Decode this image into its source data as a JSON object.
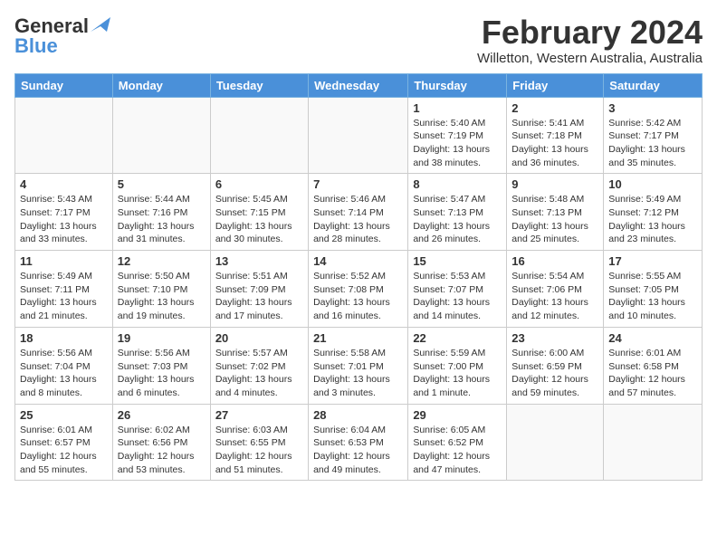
{
  "header": {
    "logo_line1": "General",
    "logo_line2": "Blue",
    "title": "February 2024",
    "subtitle": "Willetton, Western Australia, Australia"
  },
  "columns": [
    "Sunday",
    "Monday",
    "Tuesday",
    "Wednesday",
    "Thursday",
    "Friday",
    "Saturday"
  ],
  "weeks": [
    [
      {
        "day": "",
        "info": ""
      },
      {
        "day": "",
        "info": ""
      },
      {
        "day": "",
        "info": ""
      },
      {
        "day": "",
        "info": ""
      },
      {
        "day": "1",
        "info": "Sunrise: 5:40 AM\nSunset: 7:19 PM\nDaylight: 13 hours\nand 38 minutes."
      },
      {
        "day": "2",
        "info": "Sunrise: 5:41 AM\nSunset: 7:18 PM\nDaylight: 13 hours\nand 36 minutes."
      },
      {
        "day": "3",
        "info": "Sunrise: 5:42 AM\nSunset: 7:17 PM\nDaylight: 13 hours\nand 35 minutes."
      }
    ],
    [
      {
        "day": "4",
        "info": "Sunrise: 5:43 AM\nSunset: 7:17 PM\nDaylight: 13 hours\nand 33 minutes."
      },
      {
        "day": "5",
        "info": "Sunrise: 5:44 AM\nSunset: 7:16 PM\nDaylight: 13 hours\nand 31 minutes."
      },
      {
        "day": "6",
        "info": "Sunrise: 5:45 AM\nSunset: 7:15 PM\nDaylight: 13 hours\nand 30 minutes."
      },
      {
        "day": "7",
        "info": "Sunrise: 5:46 AM\nSunset: 7:14 PM\nDaylight: 13 hours\nand 28 minutes."
      },
      {
        "day": "8",
        "info": "Sunrise: 5:47 AM\nSunset: 7:13 PM\nDaylight: 13 hours\nand 26 minutes."
      },
      {
        "day": "9",
        "info": "Sunrise: 5:48 AM\nSunset: 7:13 PM\nDaylight: 13 hours\nand 25 minutes."
      },
      {
        "day": "10",
        "info": "Sunrise: 5:49 AM\nSunset: 7:12 PM\nDaylight: 13 hours\nand 23 minutes."
      }
    ],
    [
      {
        "day": "11",
        "info": "Sunrise: 5:49 AM\nSunset: 7:11 PM\nDaylight: 13 hours\nand 21 minutes."
      },
      {
        "day": "12",
        "info": "Sunrise: 5:50 AM\nSunset: 7:10 PM\nDaylight: 13 hours\nand 19 minutes."
      },
      {
        "day": "13",
        "info": "Sunrise: 5:51 AM\nSunset: 7:09 PM\nDaylight: 13 hours\nand 17 minutes."
      },
      {
        "day": "14",
        "info": "Sunrise: 5:52 AM\nSunset: 7:08 PM\nDaylight: 13 hours\nand 16 minutes."
      },
      {
        "day": "15",
        "info": "Sunrise: 5:53 AM\nSunset: 7:07 PM\nDaylight: 13 hours\nand 14 minutes."
      },
      {
        "day": "16",
        "info": "Sunrise: 5:54 AM\nSunset: 7:06 PM\nDaylight: 13 hours\nand 12 minutes."
      },
      {
        "day": "17",
        "info": "Sunrise: 5:55 AM\nSunset: 7:05 PM\nDaylight: 13 hours\nand 10 minutes."
      }
    ],
    [
      {
        "day": "18",
        "info": "Sunrise: 5:56 AM\nSunset: 7:04 PM\nDaylight: 13 hours\nand 8 minutes."
      },
      {
        "day": "19",
        "info": "Sunrise: 5:56 AM\nSunset: 7:03 PM\nDaylight: 13 hours\nand 6 minutes."
      },
      {
        "day": "20",
        "info": "Sunrise: 5:57 AM\nSunset: 7:02 PM\nDaylight: 13 hours\nand 4 minutes."
      },
      {
        "day": "21",
        "info": "Sunrise: 5:58 AM\nSunset: 7:01 PM\nDaylight: 13 hours\nand 3 minutes."
      },
      {
        "day": "22",
        "info": "Sunrise: 5:59 AM\nSunset: 7:00 PM\nDaylight: 13 hours\nand 1 minute."
      },
      {
        "day": "23",
        "info": "Sunrise: 6:00 AM\nSunset: 6:59 PM\nDaylight: 12 hours\nand 59 minutes."
      },
      {
        "day": "24",
        "info": "Sunrise: 6:01 AM\nSunset: 6:58 PM\nDaylight: 12 hours\nand 57 minutes."
      }
    ],
    [
      {
        "day": "25",
        "info": "Sunrise: 6:01 AM\nSunset: 6:57 PM\nDaylight: 12 hours\nand 55 minutes."
      },
      {
        "day": "26",
        "info": "Sunrise: 6:02 AM\nSunset: 6:56 PM\nDaylight: 12 hours\nand 53 minutes."
      },
      {
        "day": "27",
        "info": "Sunrise: 6:03 AM\nSunset: 6:55 PM\nDaylight: 12 hours\nand 51 minutes."
      },
      {
        "day": "28",
        "info": "Sunrise: 6:04 AM\nSunset: 6:53 PM\nDaylight: 12 hours\nand 49 minutes."
      },
      {
        "day": "29",
        "info": "Sunrise: 6:05 AM\nSunset: 6:52 PM\nDaylight: 12 hours\nand 47 minutes."
      },
      {
        "day": "",
        "info": ""
      },
      {
        "day": "",
        "info": ""
      }
    ]
  ]
}
